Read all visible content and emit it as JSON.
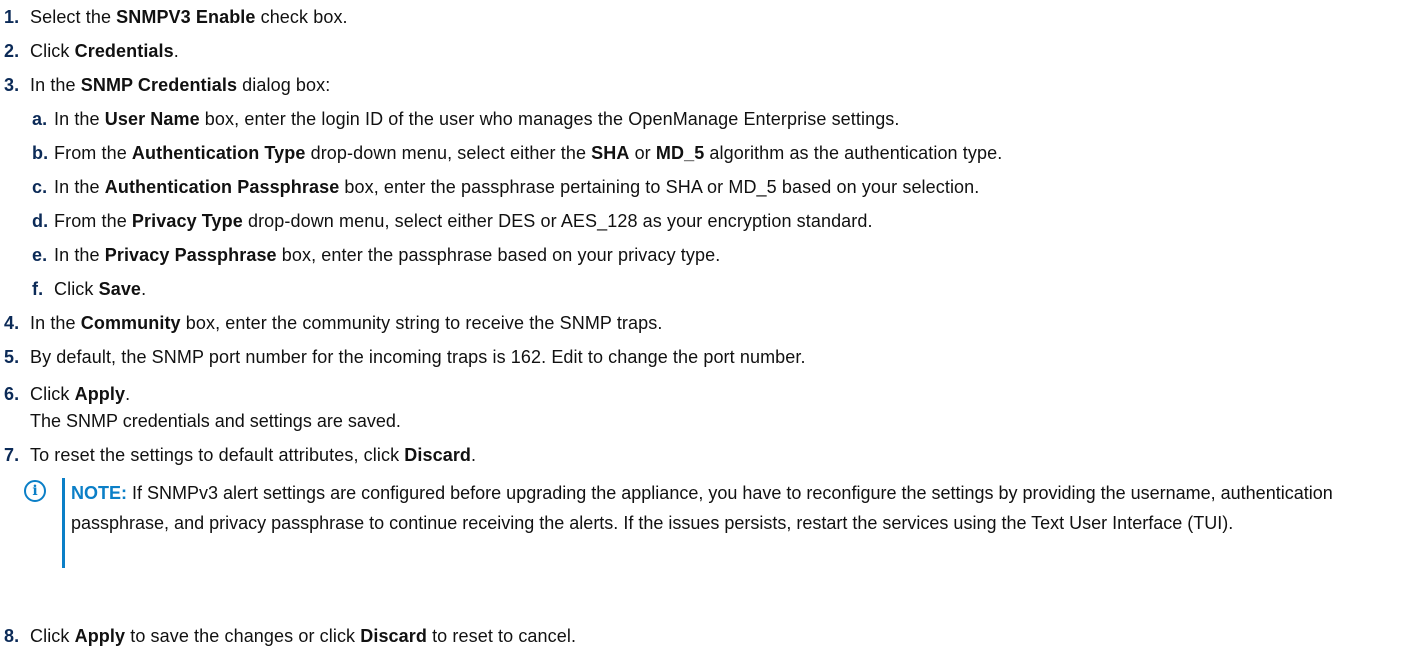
{
  "steps": [
    {
      "num": "1.",
      "pre": "Select the ",
      "b1": "SNMPV3 Enable",
      "post": " check box."
    },
    {
      "num": "2.",
      "pre": "Click ",
      "b1": "Credentials",
      "post": "."
    },
    {
      "num": "3.",
      "pre": "In the ",
      "b1": "SNMP Credentials",
      "post": " dialog box:"
    },
    {
      "num": "4.",
      "pre": "In the ",
      "b1": "Community",
      "post": " box, enter the community string to receive the SNMP traps."
    },
    {
      "num": "5.",
      "pre": "By default, the SNMP port number for the incoming traps is 162. Edit to change the port number."
    },
    {
      "num": "6.",
      "pre": "Click ",
      "b1": "Apply",
      "post": ".",
      "cont": "The SNMP credentials and settings are saved."
    },
    {
      "num": "7.",
      "pre": "To reset the settings to default attributes, click ",
      "b1": "Discard",
      "post": "."
    },
    {
      "num": "8.",
      "pre": "Click ",
      "b1": "Apply",
      "mid": " to save the changes or click ",
      "b2": "Discard",
      "post": " to reset to cancel."
    }
  ],
  "substeps": [
    {
      "num": "a.",
      "pre": "In the ",
      "b1": "User Name",
      "post": " box, enter the login ID of the user who manages the OpenManage Enterprise settings."
    },
    {
      "num": "b.",
      "pre": "From the ",
      "b1": "Authentication Type",
      "mid1": " drop-down menu, select either the ",
      "b2": "SHA",
      "mid2": " or ",
      "b3": "MD_5",
      "post": " algorithm as the authentication type."
    },
    {
      "num": "c.",
      "pre": "In the ",
      "b1": "Authentication Passphrase",
      "post": " box, enter the passphrase pertaining to SHA or MD_5 based on your selection."
    },
    {
      "num": "d.",
      "pre": "From the ",
      "b1": "Privacy Type",
      "post": " drop-down menu, select either DES or AES_128 as your encryption standard."
    },
    {
      "num": "e.",
      "pre": "In the ",
      "b1": "Privacy Passphrase",
      "post": " box, enter the passphrase based on your privacy type."
    },
    {
      "num": "f.",
      "pre": "Click ",
      "b1": "Save",
      "post": "."
    }
  ],
  "note": {
    "icon": "i",
    "label": "NOTE:",
    "text": " If SNMPv3 alert settings are configured before upgrading the appliance, you have to reconfigure the settings by providing the username, authentication passphrase, and privacy passphrase to continue receiving the alerts. If the issues persists, restart the services using the Text User Interface (TUI).",
    "accent_color": "#0b7fc7"
  }
}
